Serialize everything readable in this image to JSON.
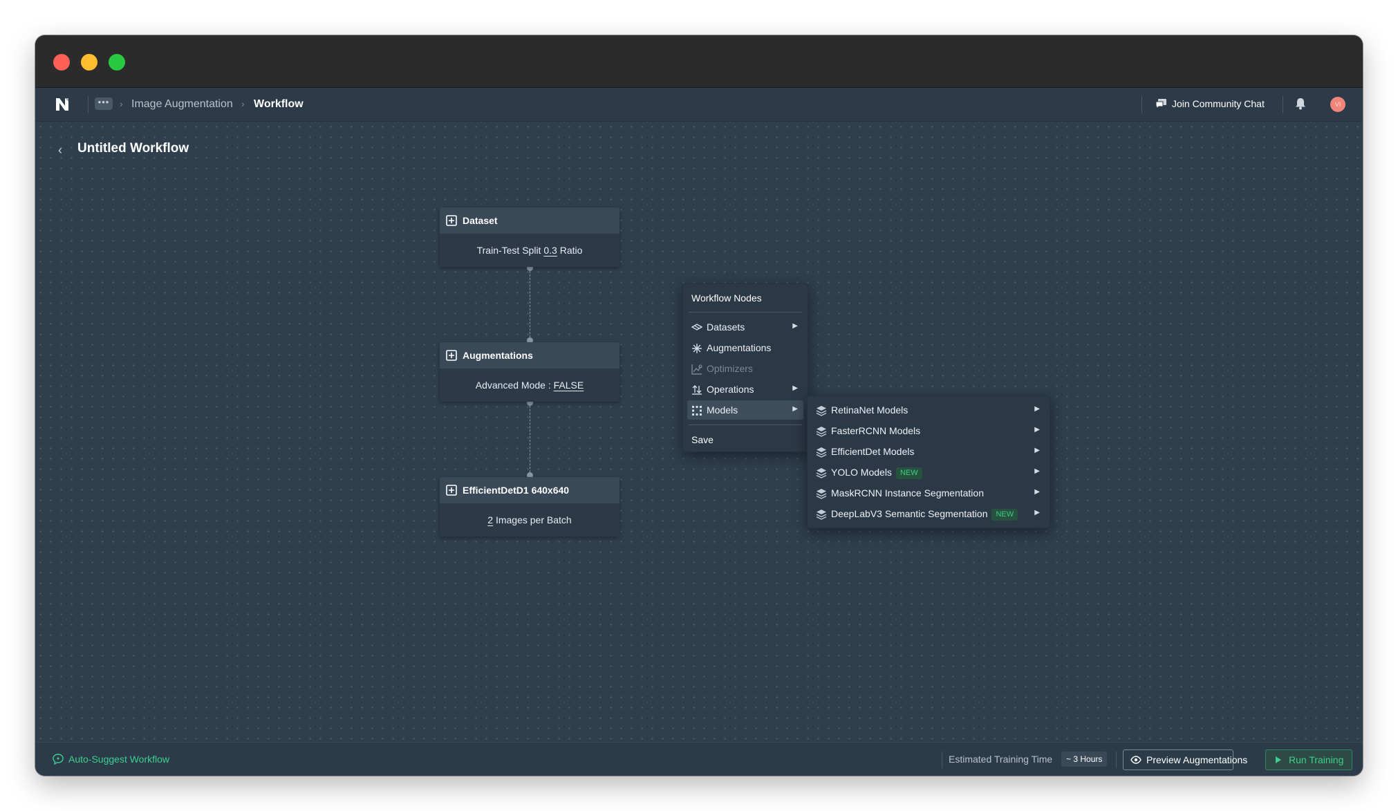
{
  "colors": {
    "accent_green": "#3fcf8e",
    "canvas_bg": "#2f3f4e",
    "node_bg": "#2c3a48",
    "new_badge_bg": "#27523f"
  },
  "breadcrumb": {
    "more": "•••",
    "items": [
      "Image Augmentation",
      "Workflow"
    ]
  },
  "header": {
    "community_label": "Join Community Chat",
    "avatar_initials": "VI"
  },
  "workflow": {
    "title": "Untitled Workflow"
  },
  "nodes": [
    {
      "title": "Dataset",
      "body_prefix": "Train-Test Split ",
      "body_value": "0.3",
      "body_suffix": " Ratio"
    },
    {
      "title": "Augmentations",
      "body_prefix": "Advanced Mode : ",
      "body_value": "FALSE",
      "body_suffix": ""
    },
    {
      "title": "EfficientDetD1 640x640",
      "body_prefix": "",
      "body_value": "2",
      "body_suffix": " Images per Batch"
    }
  ],
  "menu": {
    "header": "Workflow Nodes",
    "items": [
      {
        "label": "Datasets",
        "icon": "dataset-icon",
        "has_submenu": true
      },
      {
        "label": "Augmentations",
        "icon": "asterisk-icon",
        "has_submenu": false
      },
      {
        "label": "Optimizers",
        "icon": "chart-icon",
        "has_submenu": false,
        "disabled": true
      },
      {
        "label": "Operations",
        "icon": "operations-icon",
        "has_submenu": true
      },
      {
        "label": "Models",
        "icon": "grid-icon",
        "has_submenu": true,
        "active": true
      }
    ],
    "save_label": "Save"
  },
  "models_submenu": [
    {
      "label": "RetinaNet Models",
      "icon": "layers-icon"
    },
    {
      "label": "FasterRCNN Models",
      "icon": "layers-icon"
    },
    {
      "label": "EfficientDet Models",
      "icon": "layers-icon"
    },
    {
      "label": "YOLO Models",
      "icon": "layers-icon",
      "badge": "NEW"
    },
    {
      "label": "MaskRCNN Instance Segmentation",
      "icon": "layers-icon"
    },
    {
      "label": "DeepLabV3 Semantic Segmentation",
      "icon": "layers-icon",
      "badge": "NEW"
    }
  ],
  "footer": {
    "auto_suggest": "Auto-Suggest Workflow",
    "estimated_label": "Estimated Training Time",
    "estimated_value": "~ 3 Hours",
    "preview_label": "Preview Augmentations",
    "run_label": "Run Training"
  }
}
